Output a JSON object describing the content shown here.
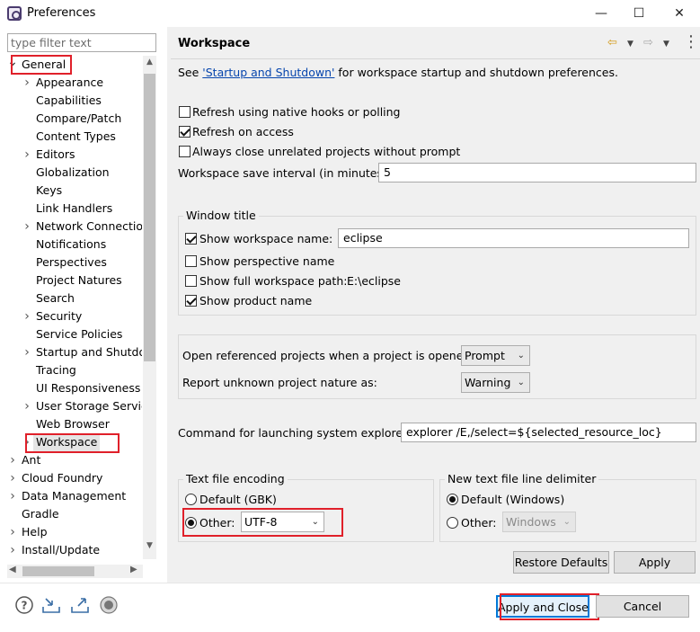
{
  "window": {
    "title": "Preferences",
    "minimize": "—",
    "maximize": "☐",
    "close": "✕"
  },
  "left": {
    "filter_placeholder": "type filter text",
    "tree": [
      {
        "label": "General",
        "level": 0,
        "twisty": "down"
      },
      {
        "label": "Appearance",
        "level": 1,
        "twisty": "right"
      },
      {
        "label": "Capabilities",
        "level": 1,
        "twisty": ""
      },
      {
        "label": "Compare/Patch",
        "level": 1,
        "twisty": ""
      },
      {
        "label": "Content Types",
        "level": 1,
        "twisty": ""
      },
      {
        "label": "Editors",
        "level": 1,
        "twisty": "right"
      },
      {
        "label": "Globalization",
        "level": 1,
        "twisty": ""
      },
      {
        "label": "Keys",
        "level": 1,
        "twisty": ""
      },
      {
        "label": "Link Handlers",
        "level": 1,
        "twisty": ""
      },
      {
        "label": "Network Connectio",
        "level": 1,
        "twisty": "right"
      },
      {
        "label": "Notifications",
        "level": 1,
        "twisty": ""
      },
      {
        "label": "Perspectives",
        "level": 1,
        "twisty": ""
      },
      {
        "label": "Project Natures",
        "level": 1,
        "twisty": ""
      },
      {
        "label": "Search",
        "level": 1,
        "twisty": ""
      },
      {
        "label": "Security",
        "level": 1,
        "twisty": "right"
      },
      {
        "label": "Service Policies",
        "level": 1,
        "twisty": ""
      },
      {
        "label": "Startup and Shutdo",
        "level": 1,
        "twisty": "right"
      },
      {
        "label": "Tracing",
        "level": 1,
        "twisty": ""
      },
      {
        "label": "UI Responsiveness",
        "level": 1,
        "twisty": ""
      },
      {
        "label": "User Storage Servic",
        "level": 1,
        "twisty": "right"
      },
      {
        "label": "Web Browser",
        "level": 1,
        "twisty": ""
      },
      {
        "label": "Workspace",
        "level": 1,
        "twisty": "right",
        "selected": true
      },
      {
        "label": "Ant",
        "level": 0,
        "twisty": "right"
      },
      {
        "label": "Cloud Foundry",
        "level": 0,
        "twisty": "right"
      },
      {
        "label": "Data Management",
        "level": 0,
        "twisty": "right"
      },
      {
        "label": "Gradle",
        "level": 0,
        "twisty": ""
      },
      {
        "label": "Help",
        "level": 0,
        "twisty": "right"
      },
      {
        "label": "Install/Update",
        "level": 0,
        "twisty": "right"
      }
    ]
  },
  "page": {
    "title": "Workspace",
    "see_prefix": "See ",
    "see_link": "'Startup and Shutdown'",
    "see_suffix": " for workspace startup and shutdown preferences.",
    "refresh_native": {
      "label": "Refresh using native hooks or polling",
      "checked": false
    },
    "refresh_access": {
      "label": "Refresh on access",
      "checked": true
    },
    "close_unrelated": {
      "label": "Always close unrelated projects without prompt",
      "checked": false
    },
    "save_interval_label": "Workspace save interval (in minutes):",
    "save_interval_value": "5",
    "window_title": {
      "group_label": "Window title",
      "show_ws_name": {
        "label": "Show workspace name:",
        "checked": true,
        "value": "eclipse"
      },
      "show_perspective": {
        "label": "Show perspective name",
        "checked": false
      },
      "show_full_path": {
        "label": "Show full workspace path:",
        "checked": false,
        "value": "E:\\eclipse"
      },
      "show_product": {
        "label": "Show product name",
        "checked": true
      }
    },
    "open_ref_label": "Open referenced projects when a project is opened:",
    "open_ref_value": "Prompt",
    "unknown_nature_label": "Report unknown project nature as:",
    "unknown_nature_value": "Warning",
    "explorer_label": "Command for launching system explorer:",
    "explorer_value": "explorer /E,/select=${selected_resource_loc}",
    "encoding": {
      "group_label": "Text file encoding",
      "default_label": "Default (GBK)",
      "other_label": "Other:",
      "other_value": "UTF-8",
      "selected": "other"
    },
    "delimiter": {
      "group_label": "New text file line delimiter",
      "default_label": "Default (Windows)",
      "other_label": "Other:",
      "other_value": "Windows",
      "selected": "default"
    },
    "restore_defaults": "Restore Defaults",
    "apply": "Apply"
  },
  "footer": {
    "apply_close": "Apply and Close",
    "cancel": "Cancel"
  },
  "colors": {
    "highlight": "#e0202a",
    "focus": "#0078d7",
    "link": "#0645ad"
  }
}
